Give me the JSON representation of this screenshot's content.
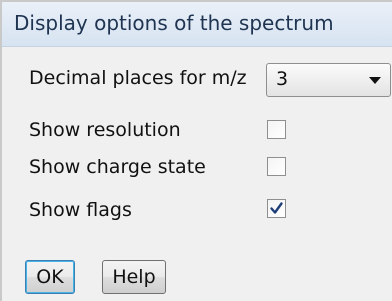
{
  "dialog": {
    "title": "Display options of the spectrum"
  },
  "fields": {
    "decimal_places_label": "Decimal places for m/z",
    "decimal_places_value": "3",
    "show_resolution_label": "Show resolution",
    "show_resolution_checked": false,
    "show_charge_state_label": "Show charge state",
    "show_charge_state_checked": false,
    "show_flags_label": "Show flags",
    "show_flags_checked": true
  },
  "buttons": {
    "ok_label": "OK",
    "help_label": "Help"
  },
  "colors": {
    "title_bar": "#d6e3f1",
    "dialog_bg": "#f0f0f0",
    "checkmark": "#1f3f7a"
  },
  "icons": {
    "dropdown": "chevron-down-icon",
    "check": "checkmark-icon"
  }
}
